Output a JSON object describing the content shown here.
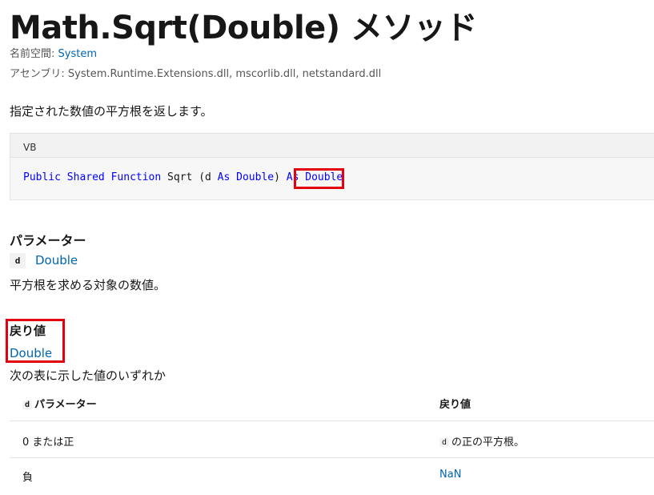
{
  "page": {
    "title": "Math.Sqrt(Double) メソッド",
    "namespace_label": "名前空間:",
    "namespace_value": "System",
    "assembly_label": "アセンブリ:",
    "assembly_value": "System.Runtime.Extensions.dll, mscorlib.dll, netstandard.dll",
    "summary": "指定された数値の平方根を返します。"
  },
  "code": {
    "language": "VB",
    "tokens": {
      "public": "Public",
      "shared": "Shared",
      "function": "Function",
      "name": "Sqrt",
      "open": "(",
      "param": "d",
      "as1": "As",
      "type1": "Double",
      "close": ")",
      "as2": "As",
      "return_type": "Double"
    }
  },
  "parameters": {
    "heading": "パラメーター",
    "items": [
      {
        "name": "d",
        "type": "Double",
        "description": "平方根を求める対象の数値。"
      }
    ]
  },
  "returns": {
    "heading": "戻り値",
    "type": "Double",
    "description": "次の表に示した値のいずれか"
  },
  "table": {
    "headers": {
      "param_code": "d",
      "param_label": "パラメーター",
      "return": "戻り値"
    },
    "rows": [
      {
        "param": "0 または正",
        "return_code": "d",
        "return_text": "の正の平方根。"
      },
      {
        "param": "負",
        "return_link": "NaN"
      }
    ]
  },
  "colors": {
    "link": "#0065b3",
    "keyword": "#0000ff",
    "highlight": "#e3000f"
  }
}
